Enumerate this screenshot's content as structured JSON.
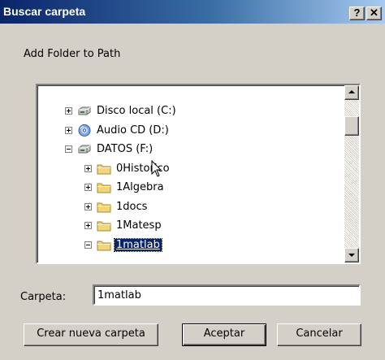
{
  "window": {
    "title": "Buscar carpeta",
    "help_label": "?",
    "close_label": "✕"
  },
  "instruction": "Add Folder to Path",
  "tree": [
    {
      "label": "Disco local (C:)",
      "icon": "drive-icon",
      "expander": "plus",
      "level": 0
    },
    {
      "label": "Audio CD (D:)",
      "icon": "cd-icon",
      "expander": "plus",
      "level": 0
    },
    {
      "label": "DATOS (F:)",
      "icon": "drive-icon",
      "expander": "minus",
      "level": 0
    },
    {
      "label": "0Historico",
      "icon": "folder-icon",
      "expander": "plus",
      "level": 1
    },
    {
      "label": "1Algebra",
      "icon": "folder-icon",
      "expander": "plus",
      "level": 1
    },
    {
      "label": "1docs",
      "icon": "folder-icon",
      "expander": "plus",
      "level": 1
    },
    {
      "label": "1Matesp",
      "icon": "folder-icon",
      "expander": "plus",
      "level": 1
    },
    {
      "label": "1matlab",
      "icon": "folder-icon",
      "expander": "minus",
      "level": 1,
      "selected": true
    }
  ],
  "folder_field": {
    "label": "Carpeta:",
    "value": "1matlab"
  },
  "buttons": {
    "new_folder": "Crear nueva carpeta",
    "ok": "Aceptar",
    "cancel": "Cancelar"
  },
  "colors": {
    "title_start": "#0a246a",
    "title_end": "#a6caf0",
    "face": "#d4d0c8",
    "selection": "#0a246a"
  }
}
